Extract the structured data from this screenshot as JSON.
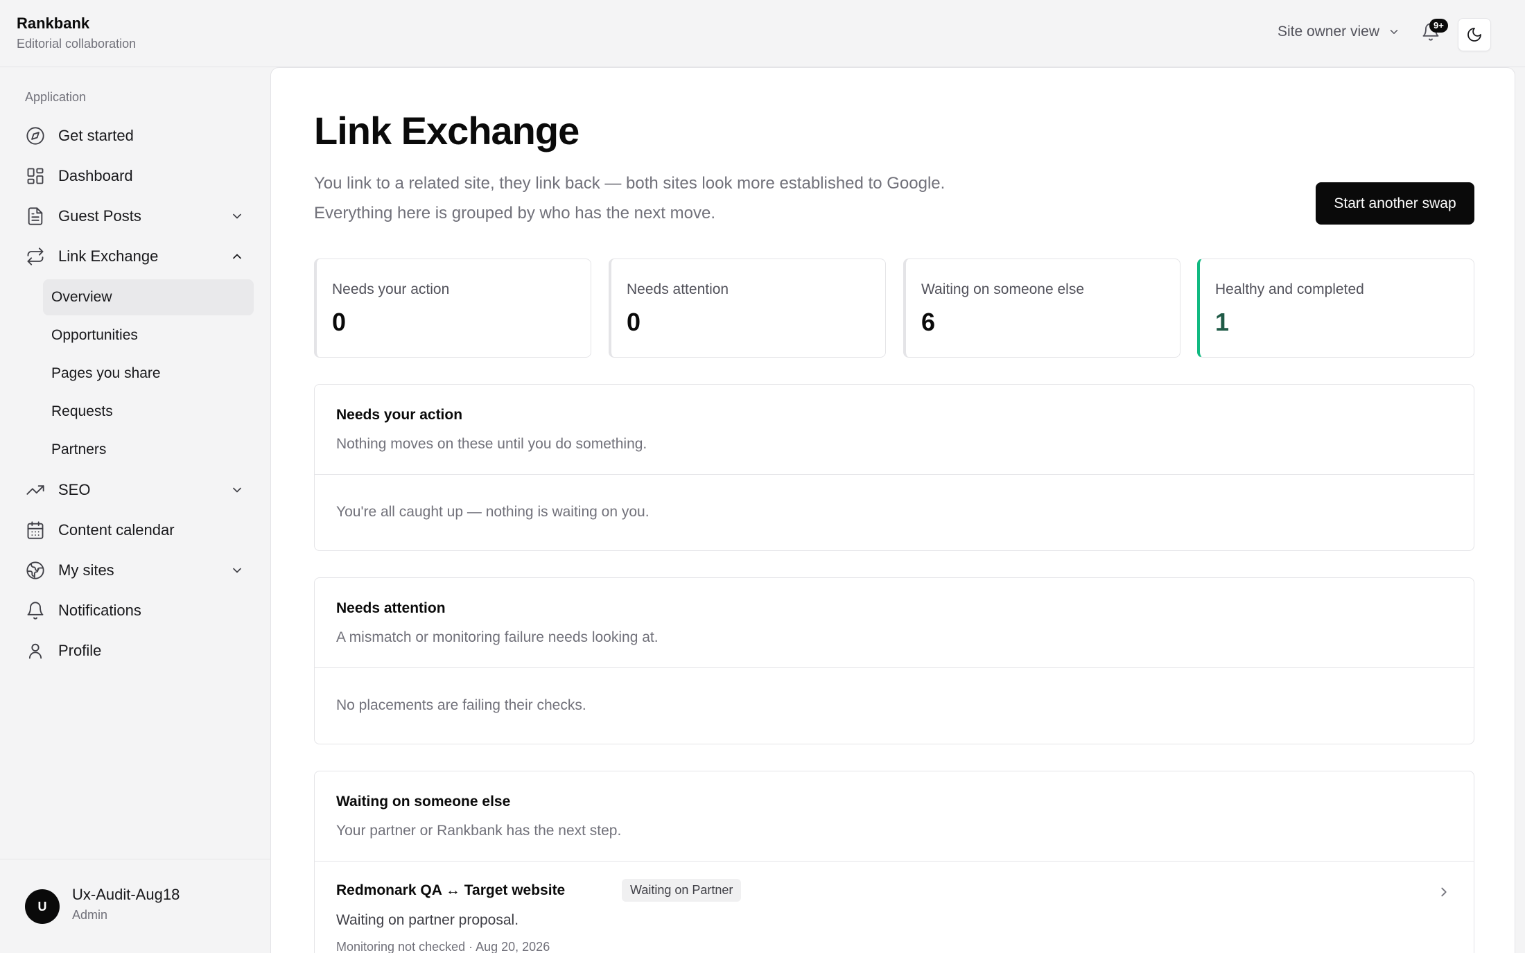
{
  "header": {
    "brand": "Rankbank",
    "brand_sub": "Editorial collaboration",
    "view_label": "Site owner view",
    "notif_badge": "9+"
  },
  "sidebar": {
    "group_label": "Application",
    "items": [
      {
        "label": "Get started",
        "icon": "compass-icon"
      },
      {
        "label": "Dashboard",
        "icon": "grid-icon"
      },
      {
        "label": "Guest Posts",
        "icon": "document-icon",
        "expandable": true,
        "expanded": false
      },
      {
        "label": "Link Exchange",
        "icon": "repeat-icon",
        "expandable": true,
        "expanded": true
      },
      {
        "label": "SEO",
        "icon": "trending-icon",
        "expandable": true,
        "expanded": false
      },
      {
        "label": "Content calendar",
        "icon": "calendar-icon"
      },
      {
        "label": "My sites",
        "icon": "globe-icon",
        "expandable": true,
        "expanded": false
      },
      {
        "label": "Notifications",
        "icon": "bell-icon"
      },
      {
        "label": "Profile",
        "icon": "user-icon"
      }
    ],
    "link_exchange_sub": [
      {
        "label": "Overview",
        "active": true
      },
      {
        "label": "Opportunities"
      },
      {
        "label": "Pages you share"
      },
      {
        "label": "Requests"
      },
      {
        "label": "Partners"
      }
    ],
    "user": {
      "initial": "U",
      "name": "Ux-Audit-Aug18",
      "role": "Admin"
    }
  },
  "main": {
    "title": "Link Exchange",
    "desc_line1": "You link to a related site, they link back — both sites look more established to Google.",
    "desc_line2": "Everything here is grouped by who has the next move.",
    "cta": "Start another swap",
    "stats": [
      {
        "label": "Needs your action",
        "value": "0"
      },
      {
        "label": "Needs attention",
        "value": "0"
      },
      {
        "label": "Waiting on someone else",
        "value": "6"
      },
      {
        "label": "Healthy and completed",
        "value": "1"
      }
    ],
    "sections": [
      {
        "title": "Needs your action",
        "sub": "Nothing moves on these until you do something.",
        "empty": "You're all caught up — nothing is waiting on you."
      },
      {
        "title": "Needs attention",
        "sub": "A mismatch or monitoring failure needs looking at.",
        "empty": "No placements are failing their checks."
      },
      {
        "title": "Waiting on someone else",
        "sub": "Your partner or Rankbank has the next step."
      }
    ],
    "waiting_rows": [
      {
        "title": "Redmonark QA ↔ Target website",
        "tag": "Waiting on Partner",
        "desc": "Waiting on partner proposal.",
        "meta": "Monitoring not checked · Aug 20, 2026"
      }
    ]
  },
  "colors": {
    "accent_healthy": "#10b981",
    "primary": "#0a0a0a"
  }
}
